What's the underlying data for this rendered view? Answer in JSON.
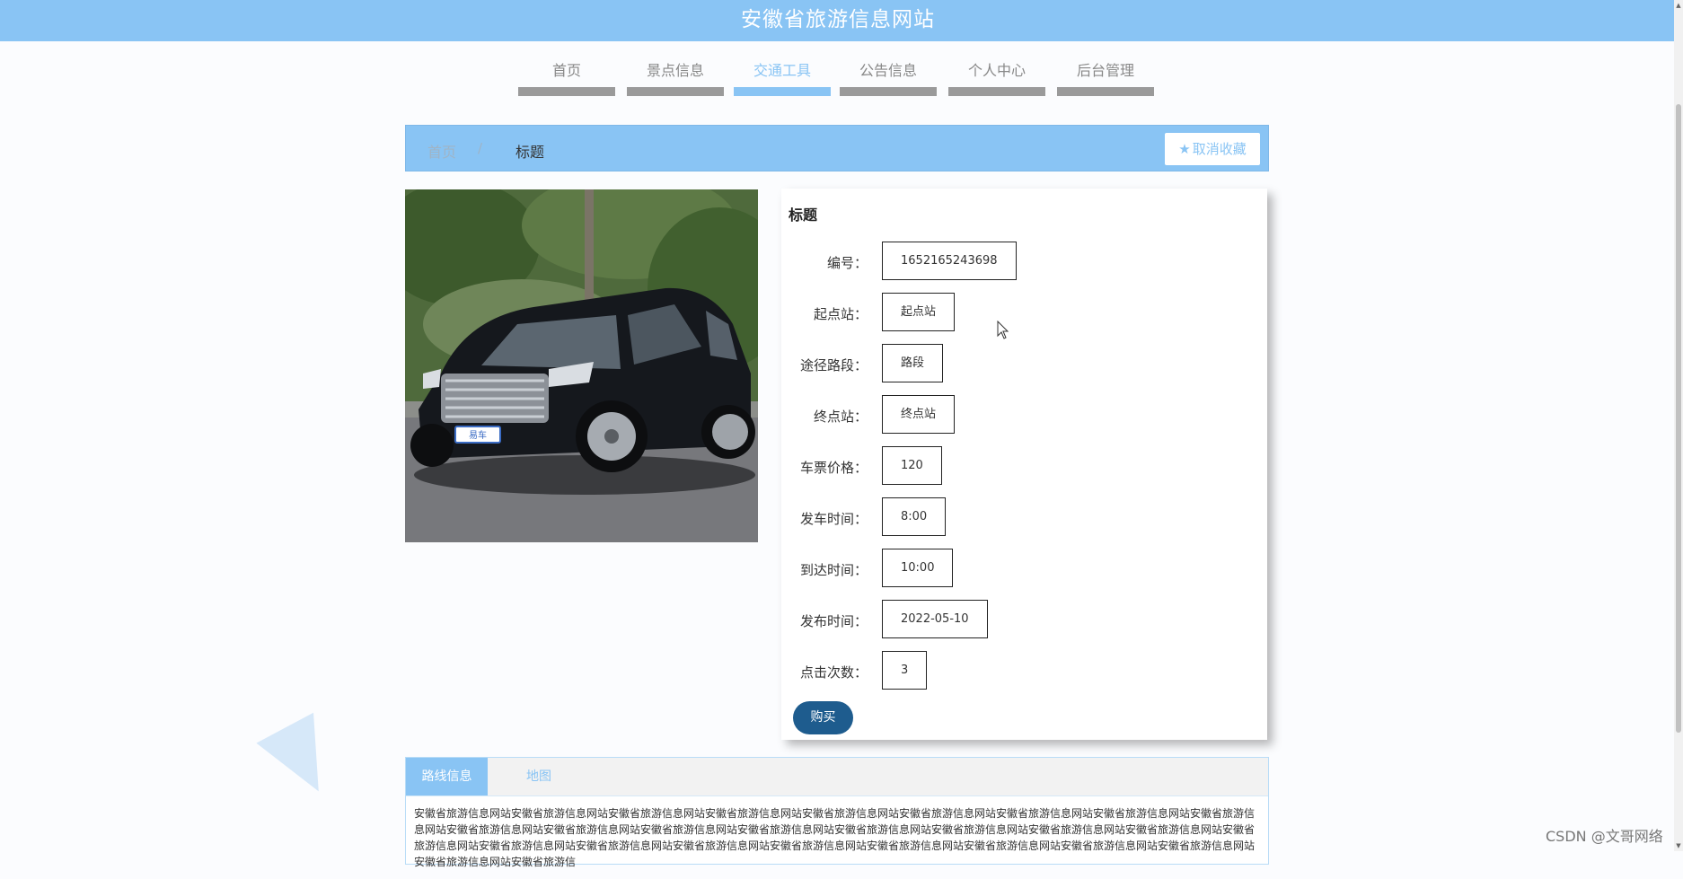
{
  "site": {
    "title": "安徽省旅游信息网站"
  },
  "nav": {
    "items": [
      "首页",
      "景点信息",
      "交通工具",
      "公告信息",
      "个人中心",
      "后台管理"
    ],
    "active_index": 2
  },
  "breadcrumb": {
    "home": "首页",
    "separator": "/",
    "current": "标题"
  },
  "favorite_button": {
    "label": "取消收藏",
    "icon": "star-icon"
  },
  "detail": {
    "title": "标题",
    "fields": [
      {
        "label": "编号：",
        "value": "1652165243698"
      },
      {
        "label": "起点站：",
        "value": "起点站"
      },
      {
        "label": "途径路段：",
        "value": "路段"
      },
      {
        "label": "终点站：",
        "value": "终点站"
      },
      {
        "label": "车票价格：",
        "value": "120"
      },
      {
        "label": "发车时间：",
        "value": "8:00"
      },
      {
        "label": "到达时间：",
        "value": "10:00"
      },
      {
        "label": "发布时间：",
        "value": "2022-05-10"
      },
      {
        "label": "点击次数：",
        "value": "3"
      }
    ],
    "buy_label": "购买",
    "plate_text": "易车"
  },
  "tabs": {
    "items": [
      "路线信息",
      "地图"
    ],
    "active_index": 0,
    "content": "安徽省旅游信息网站安徽省旅游信息网站安徽省旅游信息网站安徽省旅游信息网站安徽省旅游信息网站安徽省旅游信息网站安徽省旅游信息网站安徽省旅游信息网站安徽省旅游信息网站安徽省旅游信息网站安徽省旅游信息网站安徽省旅游信息网站安徽省旅游信息网站安徽省旅游信息网站安徽省旅游信息网站安徽省旅游信息网站安徽省旅游信息网站安徽省旅游信息网站安徽省旅游信息网站安徽省旅游信息网站安徽省旅游信息网站安徽省旅游信息网站安徽省旅游信息网站安徽省旅游信息网站安徽省旅游信息网站安徽省旅游信息网站安徽省旅游信息网站安徽省旅游信"
  },
  "watermark": "CSDN @文哥网络",
  "colors": {
    "accent": "#89c4f4",
    "buy_button": "#1e5c8e",
    "nav_bar": "#9a9a9a"
  }
}
